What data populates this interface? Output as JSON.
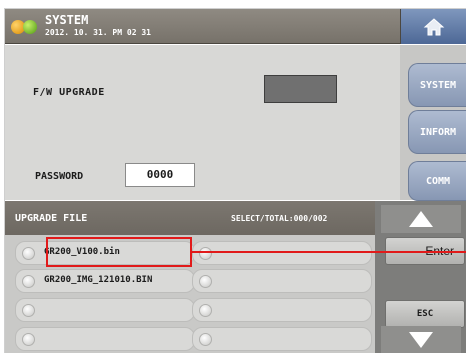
{
  "header": {
    "title": "SYSTEM",
    "datetime": "2012. 10. 31. PM 02 31",
    "icons": {
      "logo": "app-logo-icon",
      "home": "home-icon"
    }
  },
  "main": {
    "fw_upgrade_label": "F/W UPGRADE",
    "password_label": "PASSWORD",
    "password_value": "0000"
  },
  "tabs": [
    {
      "label": "SYSTEM"
    },
    {
      "label": "INFORM"
    },
    {
      "label": "COMM"
    }
  ],
  "upgrade_file": {
    "title": "UPGRADE FILE",
    "select_total": "SELECT/TOTAL:000/002",
    "files": [
      {
        "name": "GR200_V100.bin",
        "highlighted": true
      },
      {
        "name": ""
      },
      {
        "name": "GR200_IMG_121010.BIN"
      },
      {
        "name": ""
      },
      {
        "name": ""
      },
      {
        "name": ""
      },
      {
        "name": ""
      },
      {
        "name": ""
      }
    ]
  },
  "controls": {
    "enter_label": "Enter",
    "esc_label": "ESC",
    "icons": {
      "up": "triangle-up-icon",
      "down": "triangle-down-icon"
    }
  },
  "colors": {
    "header": "#7c7770",
    "tab": "#9fb0cc",
    "highlight": "#e11a1a",
    "panel": "#d8d8d6"
  }
}
